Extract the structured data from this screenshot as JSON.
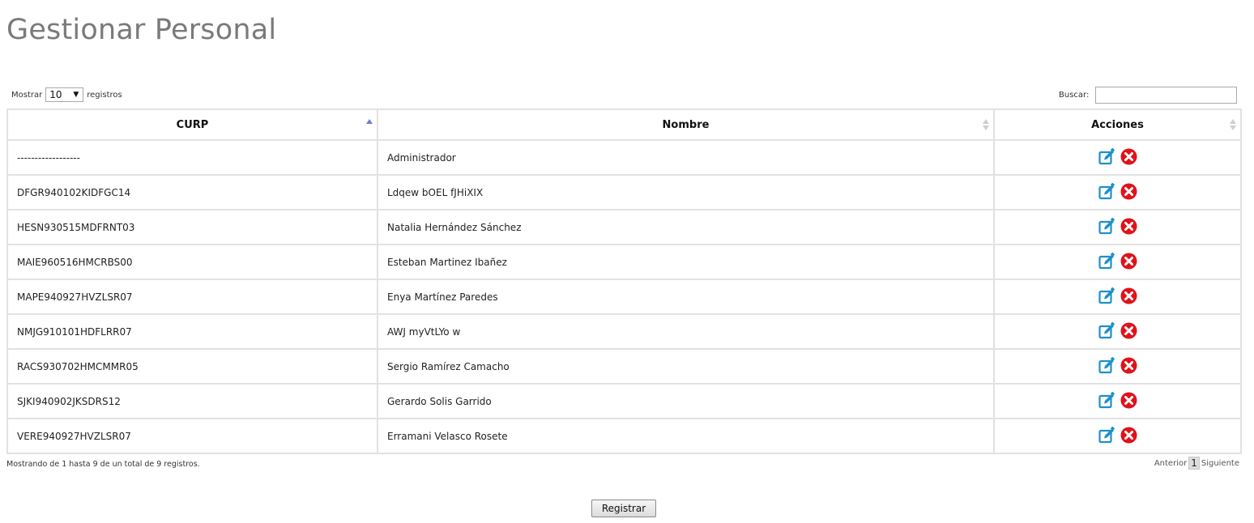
{
  "page": {
    "title": "Gestionar Personal"
  },
  "length_control": {
    "prefix": "Mostrar",
    "value": "10",
    "suffix": "registros"
  },
  "search": {
    "label": "Buscar:",
    "value": ""
  },
  "table": {
    "columns": [
      "CURP",
      "Nombre",
      "Acciones"
    ],
    "sorted_column": "CURP",
    "sort_direction": "ascending",
    "rows": [
      {
        "curp": "------------------",
        "nombre": "Administrador"
      },
      {
        "curp": "DFGR940102KIDFGC14",
        "nombre": "Ldqew bOEL fJHiXIX"
      },
      {
        "curp": "HESN930515MDFRNT03",
        "nombre": "Natalia Hernández Sánchez"
      },
      {
        "curp": "MAIE960516HMCRBS00",
        "nombre": "Esteban Martinez Ibañez"
      },
      {
        "curp": "MAPE940927HVZLSR07",
        "nombre": "Enya Martínez Paredes"
      },
      {
        "curp": "NMJG910101HDFLRR07",
        "nombre": "AWJ myVtLYo w"
      },
      {
        "curp": "RACS930702HMCMMR05",
        "nombre": "Sergio Ramírez Camacho"
      },
      {
        "curp": "SJKI940902JKSDRS12",
        "nombre": "Gerardo Solis Garrido"
      },
      {
        "curp": "VERE940927HVZLSR07",
        "nombre": "Erramani Velasco Rosete"
      }
    ],
    "row_actions": [
      "edit-icon",
      "delete-icon"
    ]
  },
  "info": {
    "text": "Mostrando de 1 hasta 9 de un total de 9 registros."
  },
  "pagination": {
    "previous": "Anterior",
    "current": "1",
    "next": "Siguiente"
  },
  "register_button": {
    "label": "Registrar"
  },
  "colors": {
    "edit_icon": "#1e90c8",
    "delete_icon": "#e0121a",
    "sort_active": "#6f7fc7",
    "title": "#7a7a7a"
  }
}
